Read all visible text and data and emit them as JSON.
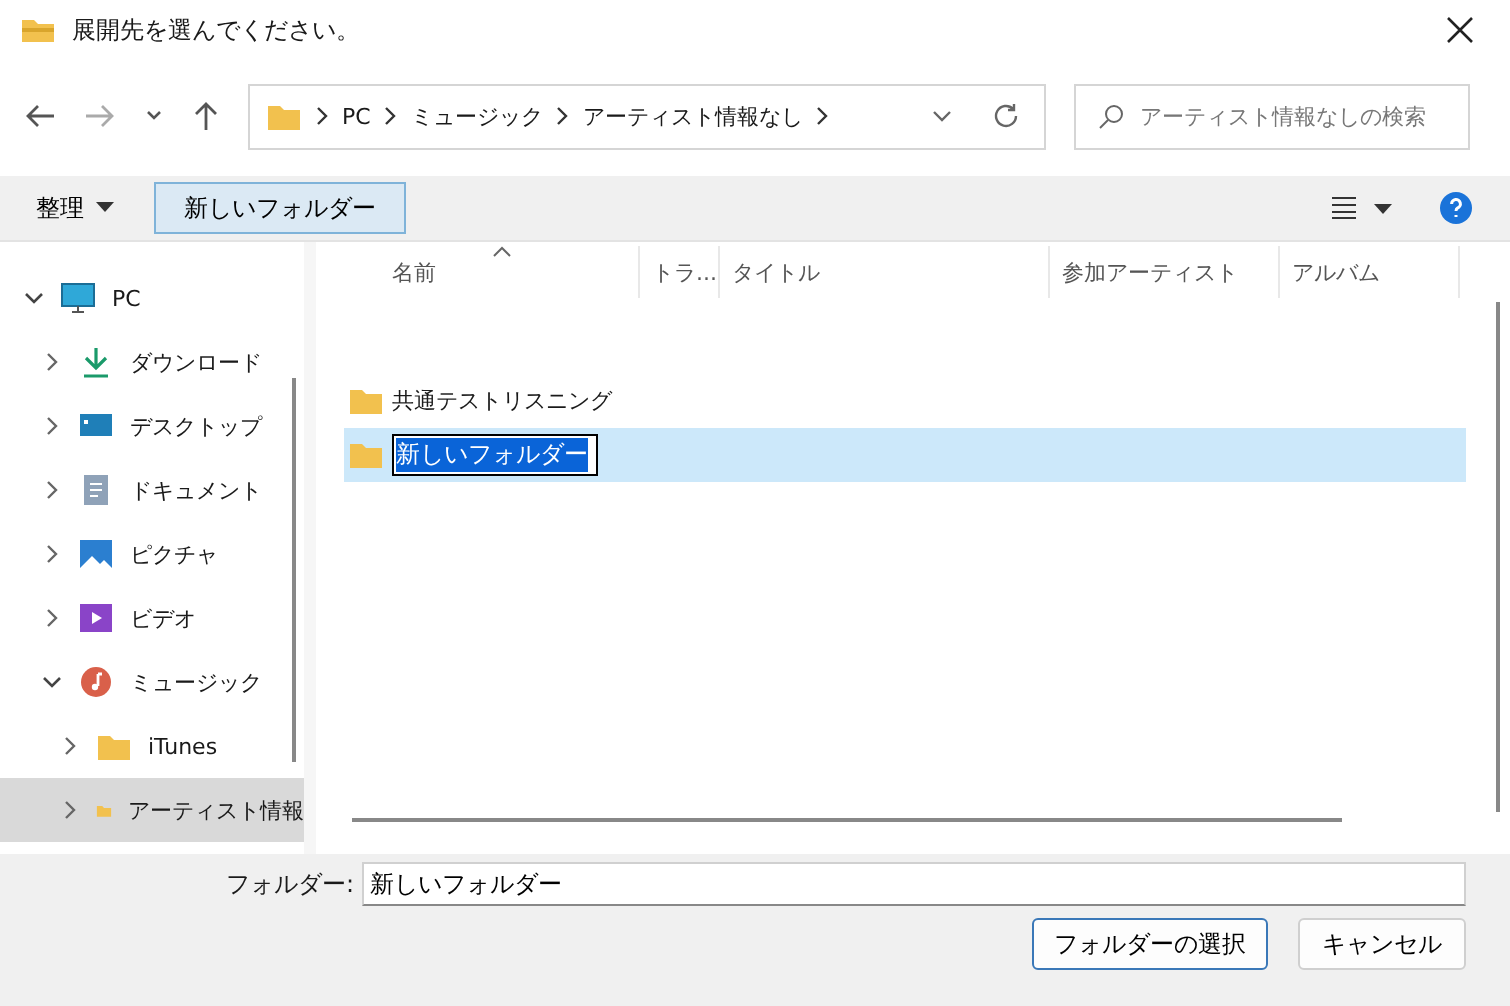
{
  "window": {
    "title": "展開先を選んでください。"
  },
  "address": {
    "segments": [
      "PC",
      "ミュージック",
      "アーティスト情報なし"
    ]
  },
  "search": {
    "placeholder": "アーティスト情報なしの検索"
  },
  "toolbar": {
    "organize": "整理",
    "new_folder": "新しいフォルダー"
  },
  "sidebar": {
    "items": [
      {
        "label": "PC",
        "kind": "pc",
        "expanded": true,
        "selected": false,
        "children": [
          {
            "label": "ダウンロード",
            "kind": "download",
            "expanded": false,
            "selected": false
          },
          {
            "label": "デスクトップ",
            "kind": "desktop",
            "expanded": false,
            "selected": false
          },
          {
            "label": "ドキュメント",
            "kind": "documents",
            "expanded": false,
            "selected": false
          },
          {
            "label": "ピクチャ",
            "kind": "pictures",
            "expanded": false,
            "selected": false
          },
          {
            "label": "ビデオ",
            "kind": "videos",
            "expanded": false,
            "selected": false
          },
          {
            "label": "ミュージック",
            "kind": "music",
            "expanded": true,
            "selected": false,
            "children": [
              {
                "label": "iTunes",
                "kind": "folder",
                "expanded": false,
                "selected": false
              },
              {
                "label": "アーティスト情報",
                "kind": "folder",
                "expanded": false,
                "selected": true
              }
            ]
          }
        ]
      }
    ]
  },
  "table": {
    "columns": [
      "名前",
      "トラ...",
      "タイトル",
      "参加アーティスト",
      "アルバム"
    ],
    "rows": [
      {
        "name": "共通テストリスニング",
        "selected": false,
        "editing": false
      },
      {
        "name": "新しいフォルダー",
        "selected": true,
        "editing": true
      }
    ]
  },
  "folder_field": {
    "label": "フォルダー:",
    "value": "新しいフォルダー"
  },
  "buttons": [
    {
      "label": "フォルダーの選択",
      "primary": true
    },
    {
      "label": "キャンセル",
      "primary": false
    }
  ]
}
